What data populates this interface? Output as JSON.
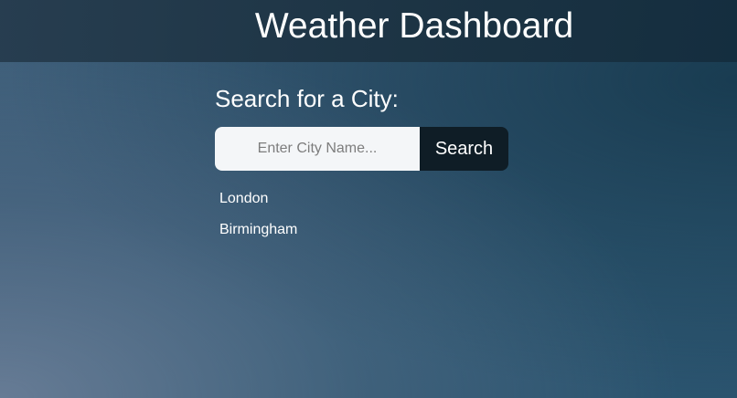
{
  "header": {
    "title": "Weather Dashboard"
  },
  "search": {
    "heading": "Search for a City:",
    "placeholder": "Enter City Name...",
    "value": "",
    "button_label": "Search"
  },
  "history": {
    "items": [
      {
        "label": "London"
      },
      {
        "label": "Birmingham"
      }
    ]
  }
}
